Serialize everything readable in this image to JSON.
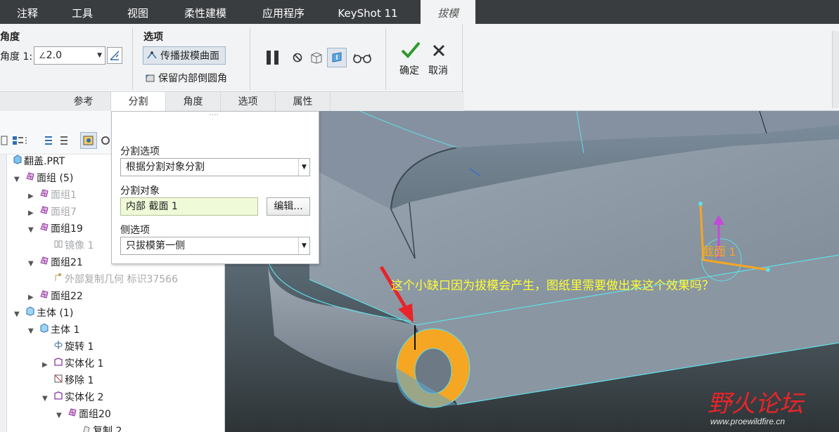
{
  "tabs": [
    {
      "label": "注释"
    },
    {
      "label": "工具"
    },
    {
      "label": "视图"
    },
    {
      "label": "柔性建模"
    },
    {
      "label": "应用程序"
    },
    {
      "label": "KeyShot 11"
    },
    {
      "label": "拔模",
      "active": true
    }
  ],
  "ribbon": {
    "angle_group_title": "角度",
    "angle1_label": "角度 1:",
    "angle1_value": "2.0",
    "options_group_title": "选项",
    "propagate_label": "传播拔模曲面",
    "keep_round_label": "保留内部倒圆角",
    "ok_label": "确定",
    "cancel_label": "取消",
    "subtabs": [
      "参考",
      "分割",
      "角度",
      "选项",
      "属性"
    ],
    "active_subtab": "分割"
  },
  "tree": {
    "root": "翻盖.PRT",
    "items": [
      {
        "label": "面组 (5)",
        "level": 0,
        "twisty": "down",
        "icon": "quilt-icon"
      },
      {
        "label": "面组1",
        "level": 1,
        "twisty": "right",
        "icon": "quilt-icon",
        "dim": true
      },
      {
        "label": "面组7",
        "level": 1,
        "twisty": "right",
        "icon": "quilt-icon",
        "dim": true
      },
      {
        "label": "面组19",
        "level": 1,
        "twisty": "down",
        "icon": "quilt-icon"
      },
      {
        "label": "镜像 1",
        "level": 2,
        "twisty": "",
        "icon": "mirror-icon",
        "dim": true
      },
      {
        "label": "面组21",
        "level": 1,
        "twisty": "down",
        "icon": "quilt-icon"
      },
      {
        "label": "外部复制几何 标识37566",
        "level": 2,
        "twisty": "",
        "icon": "external-copy-icon",
        "dim": true
      },
      {
        "label": "面组22",
        "level": 1,
        "twisty": "right",
        "icon": "quilt-icon"
      },
      {
        "label": "主体 (1)",
        "level": 0,
        "twisty": "down",
        "icon": "body-icon"
      },
      {
        "label": "主体 1",
        "level": 1,
        "twisty": "down",
        "icon": "body-icon"
      },
      {
        "label": "旋转 1",
        "level": 2,
        "twisty": "",
        "icon": "revolve-icon"
      },
      {
        "label": "实体化 1",
        "level": 2,
        "twisty": "right",
        "icon": "solidify-icon"
      },
      {
        "label": "移除 1",
        "level": 2,
        "twisty": "",
        "icon": "remove-icon"
      },
      {
        "label": "实体化 2",
        "level": 2,
        "twisty": "down",
        "icon": "solidify-icon"
      },
      {
        "label": "面组20",
        "level": 3,
        "twisty": "down",
        "icon": "quilt-icon"
      },
      {
        "label": "复制 2",
        "level": 4,
        "twisty": "",
        "icon": "copy-icon"
      }
    ]
  },
  "panel": {
    "split_options_label": "分割选项",
    "split_options_value": "根据分割对象分割",
    "split_object_label": "分割对象",
    "split_object_value": "内部 截面 1",
    "edit_button": "编辑...",
    "side_options_label": "侧选项",
    "side_options_value": "只拔模第一侧"
  },
  "viewport": {
    "section_label": "截面 1",
    "annotation": "这个小缺口因为拔模会产生，图纸里需要做出来这个效果吗？",
    "watermark_title": "野火论坛",
    "watermark_url": "www.proewildfire.cn"
  },
  "colors": {
    "tabbar": "#3a3d40",
    "ribbon": "#f2f3f4",
    "viewport_bg": "#2f3436",
    "model": "#8e99a5",
    "highlight": "#f5a623",
    "edge": "#5fe0e6",
    "annotation": "#ffff33",
    "arrow": "#e8242a",
    "watermark": "#e8242a"
  }
}
